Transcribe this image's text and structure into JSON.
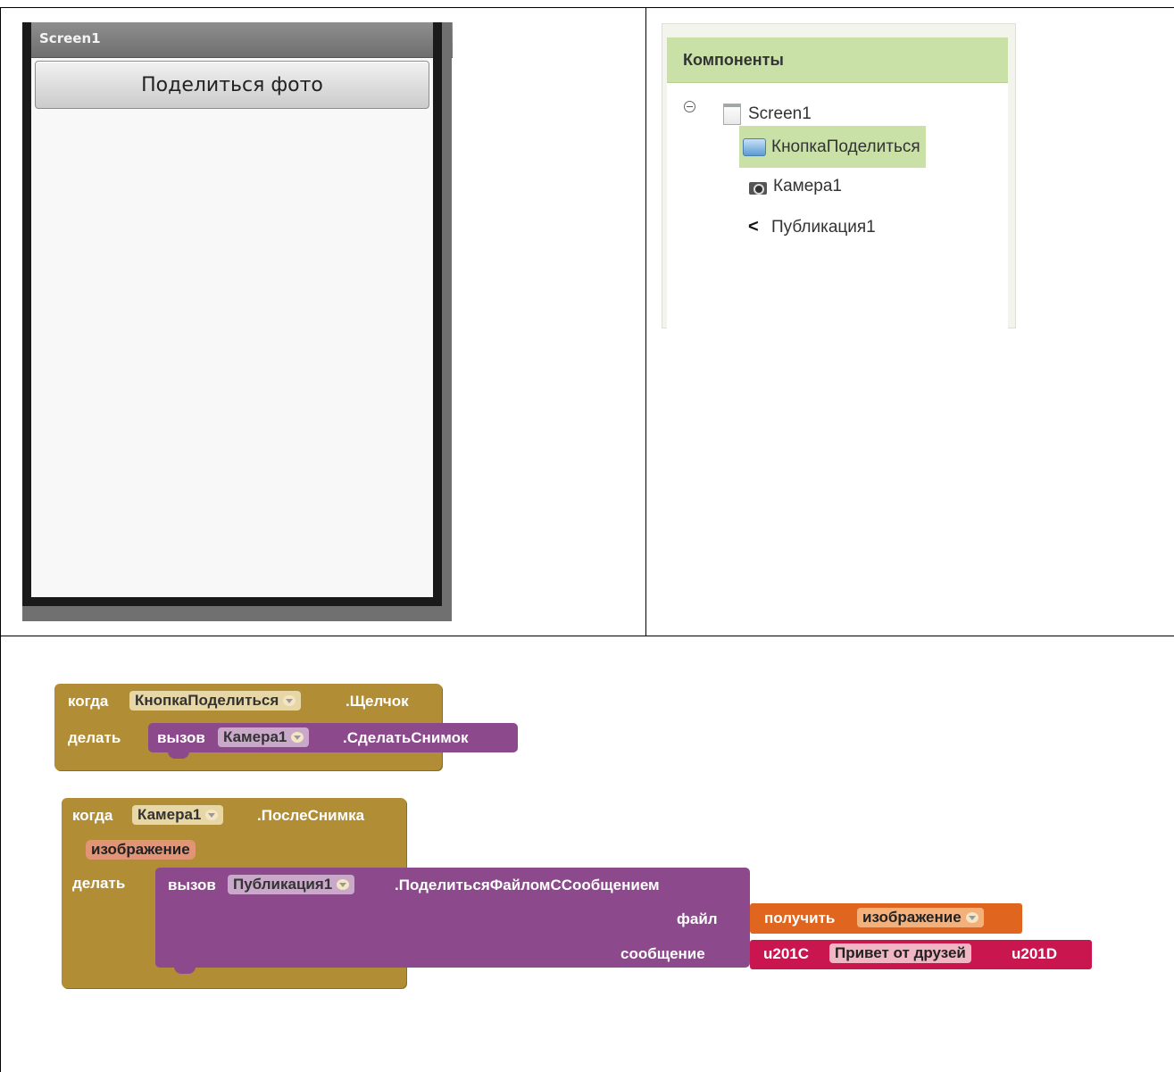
{
  "phone": {
    "title": "Screen1",
    "button_label": "Поделиться фото"
  },
  "components": {
    "header": "Компоненты",
    "tree": {
      "root": "Screen1",
      "children": [
        "КнопкаПоделиться",
        "Камера1",
        "Публикация1"
      ]
    },
    "selected": "КнопкаПоделиться"
  },
  "blocks": {
    "event1": {
      "when": "когда",
      "component": "КнопкаПоделиться",
      "event": ".Щелчок",
      "do": "делать",
      "call": "вызов",
      "target": "Камера1",
      "method": ".СделатьСнимок"
    },
    "event2": {
      "when": "когда",
      "component": "Камера1",
      "event": ".ПослеСнимка",
      "param": "изображение",
      "do": "делать",
      "call": "вызов",
      "target": "Публикация1",
      "method": ".ПоделитьсяФайломССообщением",
      "arg_file": "файл",
      "arg_message": "сообщение",
      "get": "получить",
      "get_var": "изображение",
      "quote_open": "u201C",
      "text": "Привет от друзей",
      "quote_close": "u201D"
    }
  },
  "colors": {
    "event_block": "#b18e35",
    "procedure_block": "#8c4a8c",
    "get_block": "#e0651e",
    "text_block": "#c9164f",
    "components_header": "#c9e1a6"
  }
}
